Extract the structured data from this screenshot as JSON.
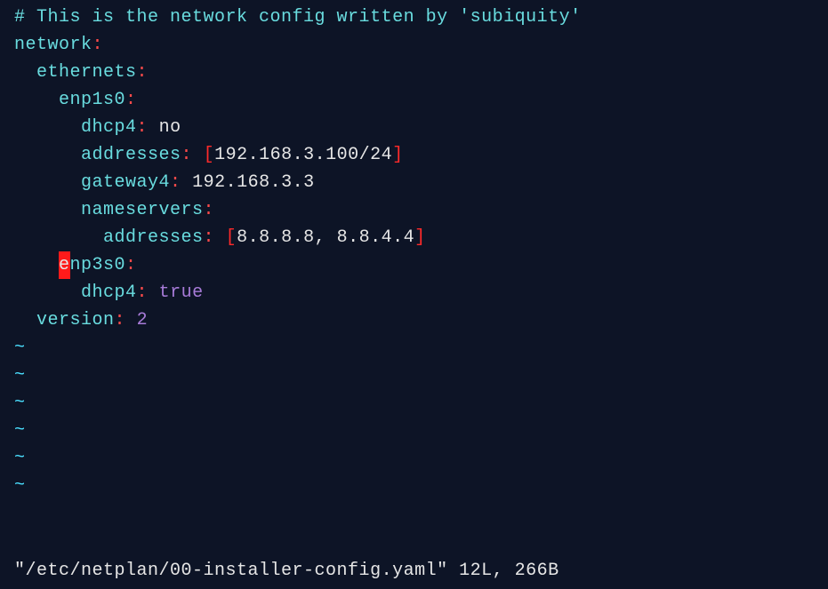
{
  "code": {
    "comment": "# This is the network config written by 'subiquity'",
    "network_key": "network",
    "ethernets_key": "ethernets",
    "if1_key": "enp1s0",
    "dhcp4_key": "dhcp4",
    "dhcp4_val1": "no",
    "addresses_key": "addresses",
    "addr_list": "192.168.3.100/24",
    "gateway4_key": "gateway4",
    "gateway4_val": "192.168.3.3",
    "nameservers_key": "nameservers",
    "ns_addresses_key": "addresses",
    "ns_list": "8.8.8.8, 8.8.4.4",
    "if2_cursor_char": "e",
    "if2_rest": "np3s0",
    "dhcp4_val2": "true",
    "version_key": "version",
    "version_val": "2",
    "tilde": "~"
  },
  "status": {
    "text": "\"/etc/netplan/00-installer-config.yaml\" 12L, 266B"
  },
  "chart_data": {
    "type": "table",
    "filename": "/etc/netplan/00-installer-config.yaml",
    "lines": 12,
    "bytes": 266,
    "network": {
      "version": 2,
      "ethernets": {
        "enp1s0": {
          "dhcp4": "no",
          "addresses": [
            "192.168.3.100/24"
          ],
          "gateway4": "192.168.3.3",
          "nameservers": {
            "addresses": [
              "8.8.8.8",
              "8.8.4.4"
            ]
          }
        },
        "enp3s0": {
          "dhcp4": true
        }
      }
    }
  }
}
